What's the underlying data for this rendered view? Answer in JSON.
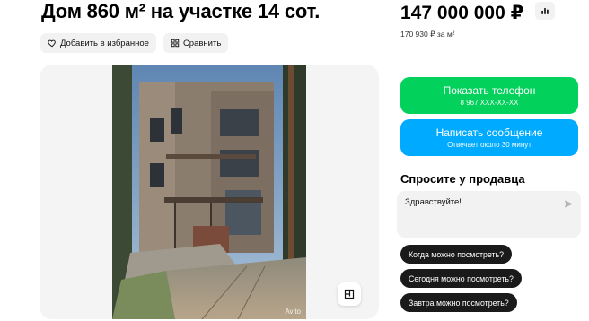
{
  "listing": {
    "title": "Дом 860 м² на участке 14 сот.",
    "price": "147 000 000 ₽",
    "price_per_sqm": "170 930 ₽ за м²"
  },
  "actions": {
    "favorite_label": "Добавить в избранное",
    "compare_label": "Сравнить"
  },
  "gallery": {
    "watermark": "Avito"
  },
  "contact": {
    "phone_label": "Показать телефон",
    "phone_masked": "8 967 XXX-XX-XX",
    "message_label": "Написать сообщение",
    "message_sub": "Отвечает около 30 минут"
  },
  "ask": {
    "title": "Спросите у продавца",
    "message_value": "Здравствуйте!",
    "quick_questions": [
      "Когда можно посмотреть?",
      "Сегодня можно посмотреть?",
      "Завтра можно посмотреть?"
    ]
  },
  "colors": {
    "phone_button": "#02d15c",
    "message_button": "#00aaff",
    "quick_chip": "#1a1a1a"
  },
  "icons": [
    "heart-icon",
    "compare-icon",
    "price-chart-icon",
    "floor-plan-icon",
    "send-icon"
  ]
}
